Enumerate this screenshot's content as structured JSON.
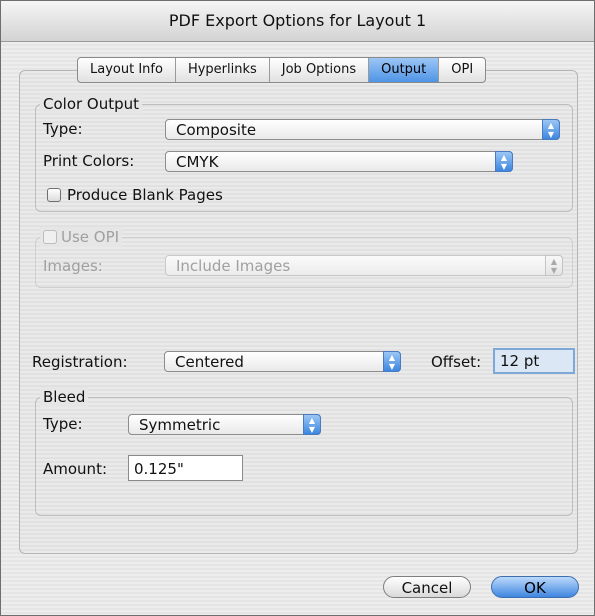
{
  "window": {
    "title": "PDF Export Options for Layout 1"
  },
  "tabs": [
    {
      "label": "Layout Info"
    },
    {
      "label": "Hyperlinks"
    },
    {
      "label": "Job Options"
    },
    {
      "label": "Output",
      "selected": true
    },
    {
      "label": "OPI"
    }
  ],
  "color_output": {
    "legend": "Color Output",
    "type_label": "Type:",
    "type_value": "Composite",
    "print_colors_label": "Print Colors:",
    "print_colors_value": "CMYK",
    "blank_pages_label": "Produce Blank Pages",
    "blank_pages_checked": false
  },
  "opi": {
    "use_opi_label": "Use OPI",
    "use_opi_checked": false,
    "images_label": "Images:",
    "images_value": "Include Images"
  },
  "registration": {
    "label": "Registration:",
    "value": "Centered",
    "offset_label": "Offset:",
    "offset_value": "12 pt"
  },
  "bleed": {
    "legend": "Bleed",
    "type_label": "Type:",
    "type_value": "Symmetric",
    "amount_label": "Amount:",
    "amount_value": "0.125\""
  },
  "buttons": {
    "cancel": "Cancel",
    "ok": "OK"
  },
  "colors": {
    "accent": "#4f94e6",
    "disabled_text": "#a0a0a0"
  },
  "icons": {
    "popup_arrows": "up-down-arrows-icon"
  }
}
